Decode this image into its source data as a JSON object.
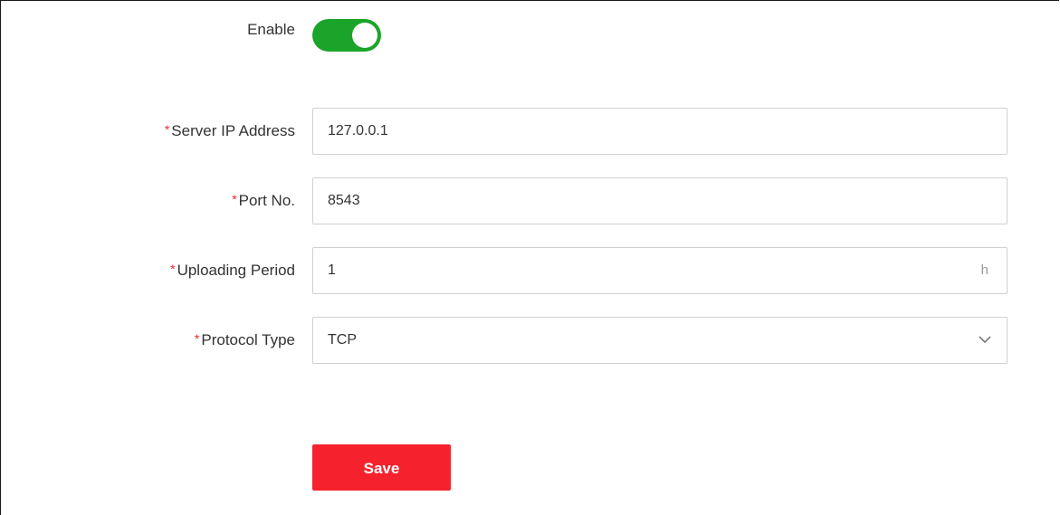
{
  "form": {
    "enable": {
      "label": "Enable",
      "state": "on",
      "accent_color": "#1aa52a"
    },
    "server_ip": {
      "required_mark": "*",
      "label": "Server IP Address",
      "value": "127.0.0.1"
    },
    "port": {
      "required_mark": "*",
      "label": "Port No.",
      "value": "8543"
    },
    "uploading_period": {
      "required_mark": "*",
      "label": "Uploading Period",
      "value": "1",
      "unit": "h"
    },
    "protocol_type": {
      "required_mark": "*",
      "label": "Protocol Type",
      "selected": "TCP",
      "icon": "chevron-down-icon"
    }
  },
  "actions": {
    "save_label": "Save",
    "save_color": "#f5222d"
  }
}
